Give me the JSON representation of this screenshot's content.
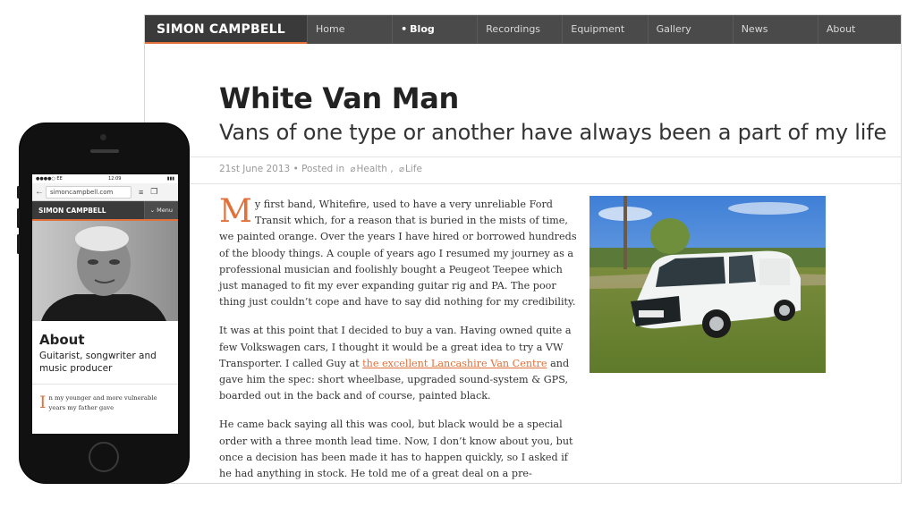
{
  "desktop": {
    "nav": {
      "brand": "SIMON CAMPBELL",
      "items": [
        {
          "label": "Home",
          "active": false
        },
        {
          "label": "Blog",
          "active": true
        },
        {
          "label": "Recordings",
          "active": false
        },
        {
          "label": "Equipment",
          "active": false
        },
        {
          "label": "Gallery",
          "active": false
        },
        {
          "label": "News",
          "active": false
        },
        {
          "label": "About",
          "active": false
        }
      ]
    },
    "post": {
      "title": "White Van Man",
      "subtitle": "Vans of one type or another have always been a part of my life",
      "date": "21st June 2013",
      "posted_in": "Posted in",
      "tags": [
        "Health",
        "Life"
      ],
      "tag_separator": ","
    },
    "article": {
      "dropcap": "M",
      "p1": "y first band, Whitefire, used to have a very unreliable Ford Transit which, for a reason that is buried in the mists of time, we painted orange. Over the years I have hired or borrowed hundreds of the bloody things. A couple of years ago I resumed my journey as a professional musician and foolishly bought a Peugeot Teepee which just managed to fit my ever expanding guitar rig and PA. The poor thing just couldn’t cope and have to say did nothing for my credibility.",
      "p2_before": "It was at this point that I decided to buy a van. Having owned quite a few Volkswagen cars, I thought it would be a great idea to try a VW Transporter. I called Guy at",
      "p2_link": "the excellent Lancashire Van Centre",
      "p2_after": "and gave him the spec: short wheelbase, upgraded sound-system & GPS, boarded out in the back and of course, painted black.",
      "p3": "He came back saying all this was cool, but black would be a special order with a three month lead time. Now, I don’t know about you, but once a decision has been made it has to happen quickly, so I asked if he had anything in stock. He told me of a great deal on a pre-registered van, so asked"
    },
    "colors": {
      "accent": "#e2703a",
      "nav_bg": "#4a4a4a",
      "brand_bg": "#3a3a3a"
    }
  },
  "phone": {
    "status": {
      "carrier": "EE",
      "time": "12:09"
    },
    "url": "simoncampbell.com",
    "brand": "SIMON CAMPBELL",
    "menu_label": "Menu",
    "about_heading": "About",
    "tagline": "Guitarist, songwriter and music producer",
    "dropcap": "I",
    "body": "n my younger and more vulnerable years my father gave"
  }
}
